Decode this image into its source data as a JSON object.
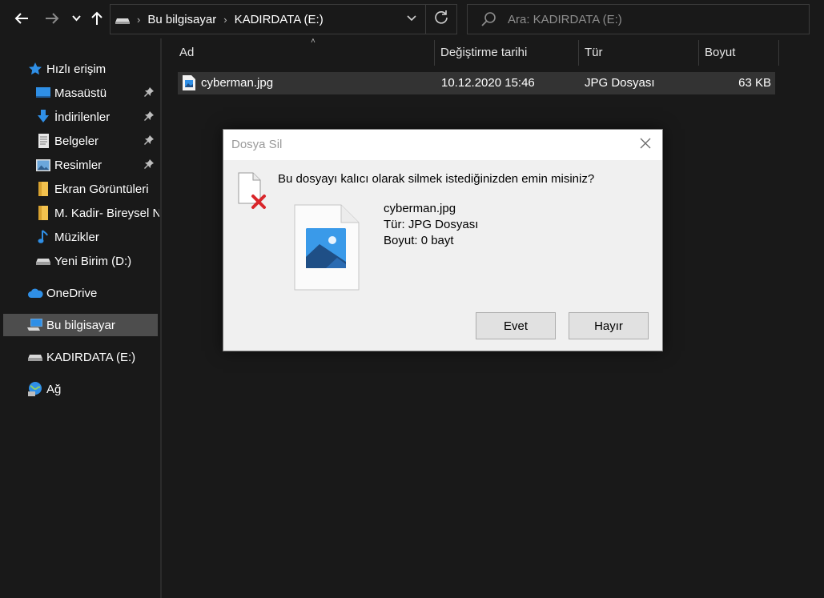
{
  "address_bar": {
    "crumbs": [
      "Bu bilgisayar",
      "KADIRDATA (E:)"
    ],
    "search_placeholder": "Ara: KADIRDATA (E:)"
  },
  "sidebar": {
    "items": [
      {
        "label": "Hızlı erişim",
        "icon": "star-icon"
      },
      {
        "label": "Masaüstü",
        "icon": "desktop-icon",
        "pinned": true
      },
      {
        "label": "İndirilenler",
        "icon": "download-icon",
        "pinned": true
      },
      {
        "label": "Belgeler",
        "icon": "documents-icon",
        "pinned": true
      },
      {
        "label": "Resimler",
        "icon": "pictures-icon",
        "pinned": true
      },
      {
        "label": "Ekran Görüntüleri",
        "icon": "folder-icon"
      },
      {
        "label": "M. Kadir- Bireysel N",
        "icon": "folder-icon"
      },
      {
        "label": "Müzikler",
        "icon": "music-icon"
      },
      {
        "label": "Yeni Birim (D:)",
        "icon": "drive-icon"
      },
      {
        "label": "OneDrive",
        "icon": "cloud-icon"
      },
      {
        "label": "Bu bilgisayar",
        "icon": "computer-icon",
        "selected": true
      },
      {
        "label": "KADIRDATA (E:)",
        "icon": "drive-icon"
      },
      {
        "label": "Ağ",
        "icon": "network-icon"
      }
    ]
  },
  "file_list": {
    "columns": [
      "Ad",
      "Değiştirme tarihi",
      "Tür",
      "Boyut"
    ],
    "rows": [
      {
        "name": "cyberman.jpg",
        "modified": "10.12.2020 15:46",
        "type": "JPG Dosyası",
        "size": "63 KB"
      }
    ]
  },
  "dialog": {
    "title": "Dosya Sil",
    "message": "Bu dosyayı kalıcı olarak silmek istediğinizden emin misiniz?",
    "file_name": "cyberman.jpg",
    "file_type": "Tür: JPG Dosyası",
    "file_size": "Boyut: 0 bayt",
    "yes_label": "Evet",
    "no_label": "Hayır"
  },
  "colors": {
    "background": "#191919",
    "selected_row": "#333333",
    "dialog_bg": "#f0f0f0",
    "accent_blue": "#0078d4",
    "delete_red": "#d9262b"
  }
}
